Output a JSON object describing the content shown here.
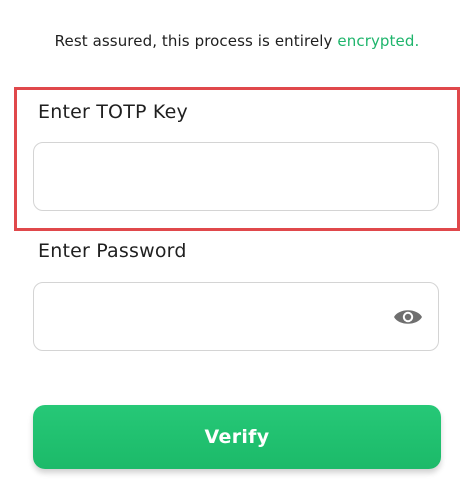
{
  "notice": {
    "text": "Rest assured, this process is entirely",
    "accent": "encrypted."
  },
  "totp": {
    "label": "Enter TOTP Key",
    "value": ""
  },
  "password": {
    "label": "Enter Password",
    "value": "",
    "toggle_icon": "eye-icon"
  },
  "verify_button": {
    "label": "Verify"
  },
  "colors": {
    "accent": "#1fb56c",
    "highlight": "#e0484b",
    "button": "#22c26f"
  }
}
